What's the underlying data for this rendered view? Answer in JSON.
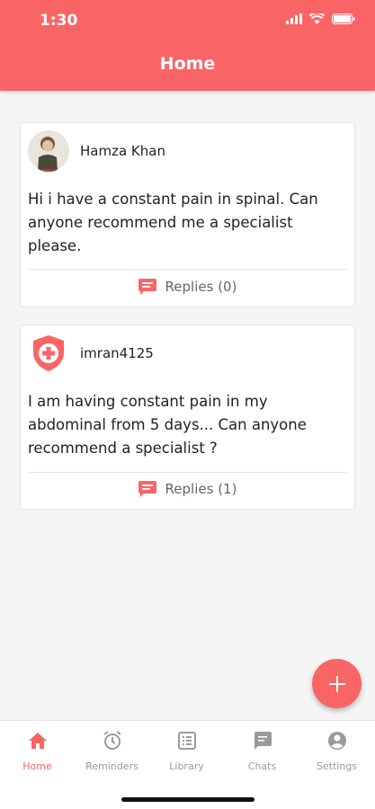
{
  "status": {
    "time": "1:30"
  },
  "header": {
    "title": "Home"
  },
  "posts": [
    {
      "username": "Hamza Khan",
      "text": "Hi i have a constant pain in spinal. Can anyone recommend me a specialist please.",
      "replies": "Replies (0)",
      "avatar": "photo"
    },
    {
      "username": "imran4125",
      "text": "I am having constant pain in my abdominal from 5 days... Can anyone recommend a specialist ?",
      "replies": "Replies (1)",
      "avatar": "medical-shield-icon"
    }
  ],
  "fab": {
    "icon": "+"
  },
  "tabs": [
    {
      "label": "Home",
      "icon": "home-icon",
      "active": true
    },
    {
      "label": "Reminders",
      "icon": "alarm-clock-icon"
    },
    {
      "label": "Library",
      "icon": "library-icon"
    },
    {
      "label": "Chats",
      "icon": "chat-icon"
    },
    {
      "label": "Settings",
      "icon": "account-icon"
    }
  ],
  "colors": {
    "accent": "#f96566",
    "text": "#222222",
    "muted": "#999999"
  }
}
